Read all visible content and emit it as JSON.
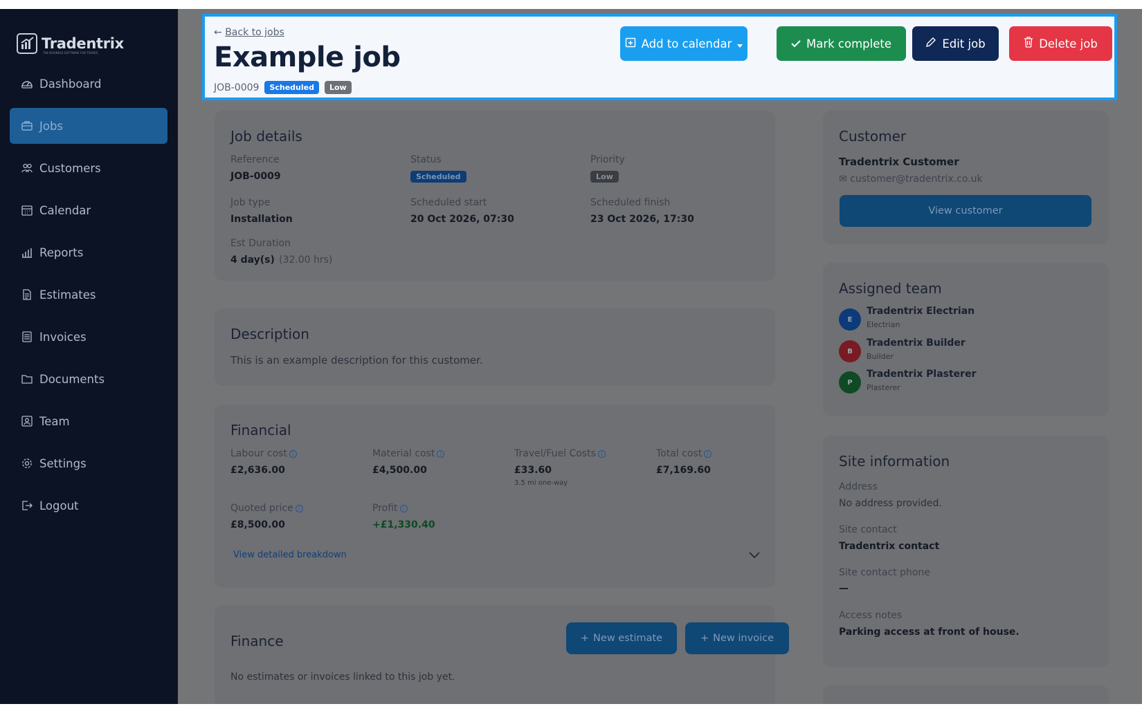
{
  "app": {
    "brand": "Tradentrix",
    "tagline": "THE BUSINESS SOFTWARE FOR TRADES"
  },
  "sidebar": {
    "items": [
      {
        "label": "Dashboard",
        "icon": "dashboard-icon",
        "active": false
      },
      {
        "label": "Jobs",
        "icon": "briefcase-icon",
        "active": true
      },
      {
        "label": "Customers",
        "icon": "users-icon",
        "active": false
      },
      {
        "label": "Calendar",
        "icon": "calendar-icon",
        "active": false
      },
      {
        "label": "Reports",
        "icon": "bar-chart-icon",
        "active": false
      },
      {
        "label": "Estimates",
        "icon": "document-icon",
        "active": false
      },
      {
        "label": "Invoices",
        "icon": "invoice-icon",
        "active": false
      },
      {
        "label": "Documents",
        "icon": "folder-icon",
        "active": false
      },
      {
        "label": "Team",
        "icon": "id-card-icon",
        "active": false
      },
      {
        "label": "Settings",
        "icon": "gear-icon",
        "active": false
      },
      {
        "label": "Logout",
        "icon": "logout-icon",
        "active": false
      }
    ]
  },
  "header": {
    "back_label": "Back to jobs",
    "title": "Example job",
    "job_ref": "JOB-0009",
    "status_badge": "Scheduled",
    "priority_badge": "Low",
    "buttons": {
      "add_to_calendar": "Add to calendar",
      "mark_complete": "Mark complete",
      "edit_job": "Edit job",
      "delete_job": "Delete job"
    }
  },
  "job_details": {
    "title": "Job details",
    "reference_label": "Reference",
    "reference_value": "JOB-0009",
    "status_label": "Status",
    "status_value": "Scheduled",
    "priority_label": "Priority",
    "priority_value": "Low",
    "job_type_label": "Job type",
    "job_type_value": "Installation",
    "start_label": "Scheduled start",
    "start_value": "20 Oct 2026, 07:30",
    "finish_label": "Scheduled finish",
    "finish_value": "23 Oct 2026, 17:30",
    "duration_label": "Est Duration",
    "duration_days": "4 day(s)",
    "duration_hours": "(32.00 hrs)"
  },
  "description": {
    "title": "Description",
    "text": "This is an example description for this customer."
  },
  "financial": {
    "title": "Financial",
    "labour_label": "Labour cost",
    "labour_value": "£2,636.00",
    "material_label": "Material cost",
    "material_value": "£4,500.00",
    "travel_label": "Travel/Fuel Costs",
    "travel_value": "£33.60",
    "travel_note": "3.5 mi one-way",
    "total_label": "Total cost",
    "total_value": "£7,169.60",
    "quoted_label": "Quoted price",
    "quoted_value": "£8,500.00",
    "profit_label": "Profit",
    "profit_value": "+£1,330.40",
    "breakdown_link": "View detailed breakdown"
  },
  "finance": {
    "title": "Finance",
    "new_estimate": "New estimate",
    "new_invoice": "New invoice",
    "empty_text": "No estimates or invoices linked to this job yet."
  },
  "customer": {
    "title": "Customer",
    "name": "Tradentrix Customer",
    "email": "customer@tradentrix.co.uk",
    "view_button": "View customer"
  },
  "team": {
    "title": "Assigned team",
    "members": [
      {
        "initial": "E",
        "name": "Tradentrix Electrian",
        "role": "Electrian",
        "color": "#0d3a78"
      },
      {
        "initial": "B",
        "name": "Tradentrix Builder",
        "role": "Builder",
        "color": "#7a1a22"
      },
      {
        "initial": "P",
        "name": "Tradentrix Plasterer",
        "role": "Plasterer",
        "color": "#0f4a25"
      }
    ]
  },
  "site": {
    "title": "Site information",
    "address_label": "Address",
    "address_value": "No address provided.",
    "contact_label": "Site contact",
    "contact_value": "Tradentrix contact",
    "phone_label": "Site contact phone",
    "phone_value": "—",
    "notes_label": "Access notes",
    "notes_value": "Parking access at front of house."
  },
  "colors": {
    "sidebar_bg": "#0b1325",
    "active_nav": "#1d5e97",
    "calendar_btn": "#1a9ff0",
    "complete_btn": "#1c8d4f",
    "edit_btn": "#0f2855",
    "delete_btn": "#e53645",
    "highlight": "#199bf2"
  }
}
